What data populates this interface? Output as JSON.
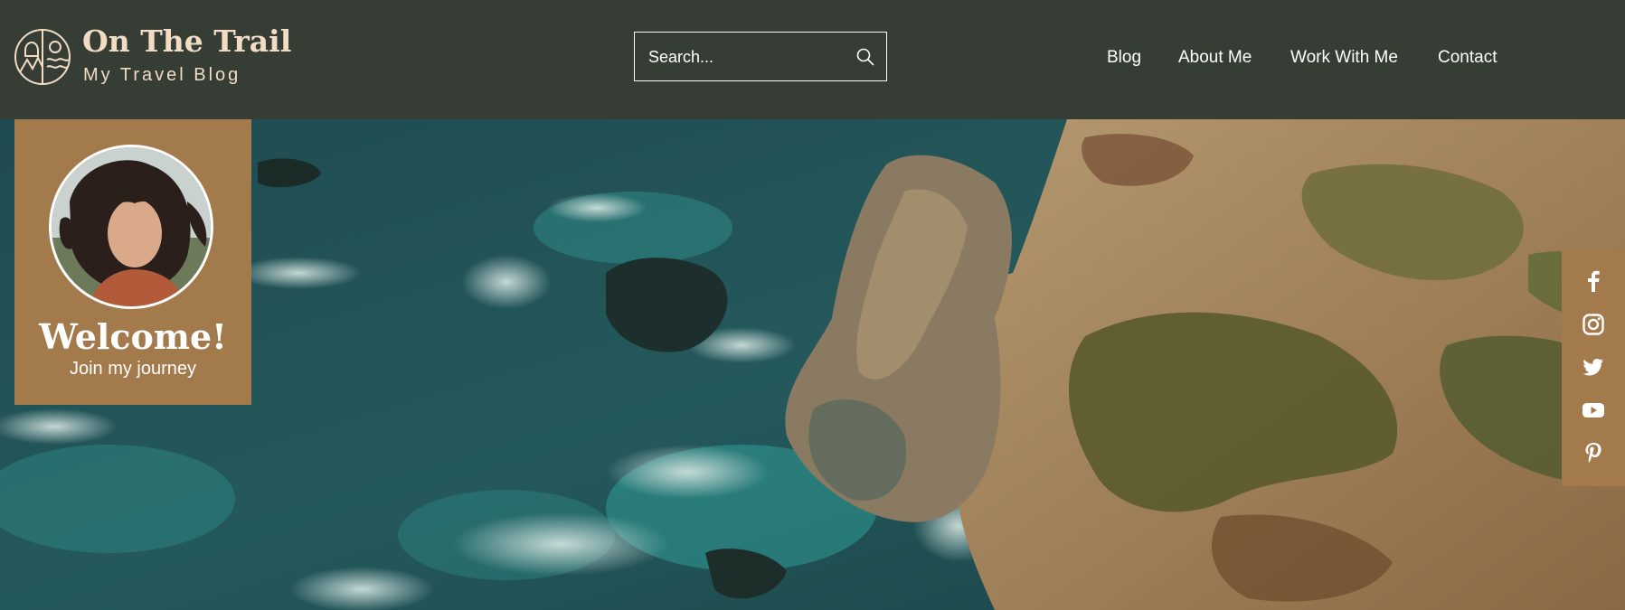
{
  "brand": {
    "title": "On The Trail",
    "subtitle": "My Travel Blog",
    "logo_icon": "trail-logo-icon"
  },
  "search": {
    "placeholder": "Search...",
    "icon": "search-icon"
  },
  "nav": {
    "items": [
      {
        "label": "Blog"
      },
      {
        "label": "About Me"
      },
      {
        "label": "Work With Me"
      },
      {
        "label": "Contact"
      }
    ]
  },
  "welcome": {
    "title": "Welcome!",
    "subtitle": "Join my journey"
  },
  "social": {
    "items": [
      {
        "icon": "facebook-icon"
      },
      {
        "icon": "instagram-icon"
      },
      {
        "icon": "twitter-icon"
      },
      {
        "icon": "youtube-icon"
      },
      {
        "icon": "pinterest-icon"
      }
    ]
  },
  "colors": {
    "header_bg": "#353d35",
    "accent": "#a37a4b",
    "brand_text": "#f2dcc4"
  }
}
